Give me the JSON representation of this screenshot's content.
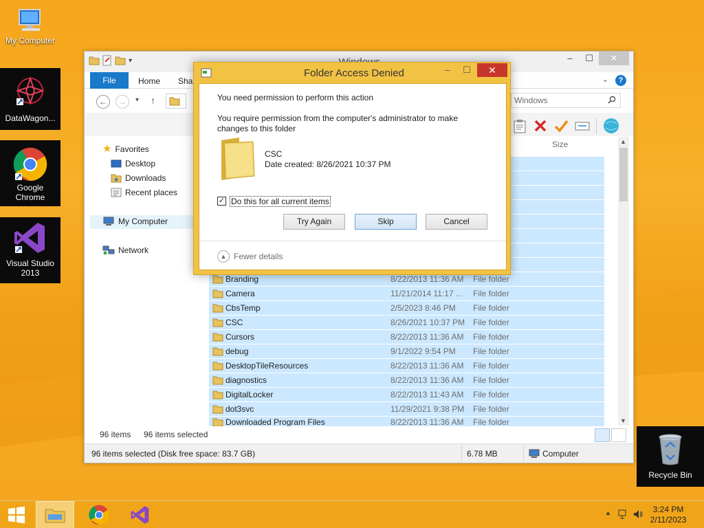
{
  "desktop": {
    "icons": [
      {
        "label": "My Computer"
      },
      {
        "label": "DataWagon..."
      },
      {
        "label": "Google\nChrome"
      },
      {
        "label": "Visual Studio\n2013"
      },
      {
        "label": "Recycle Bin"
      }
    ]
  },
  "explorer": {
    "title": "Windows",
    "tabs": {
      "file": "File",
      "home": "Home",
      "share": "Shar"
    },
    "search_placeholder": "Windows",
    "column_size": "Size",
    "nav": {
      "favorites": "Favorites",
      "desktop": "Desktop",
      "downloads": "Downloads",
      "recent": "Recent places",
      "computer": "My Computer",
      "network": "Network"
    },
    "rows": [
      {
        "name": "Branding",
        "date": "8/22/2013 11:36 AM",
        "type": "File folder"
      },
      {
        "name": "Camera",
        "date": "11/21/2014 11:17 ...",
        "type": "File folder"
      },
      {
        "name": "CbsTemp",
        "date": "2/5/2023 8:46 PM",
        "type": "File folder"
      },
      {
        "name": "CSC",
        "date": "8/26/2021 10:37 PM",
        "type": "File folder"
      },
      {
        "name": "Cursors",
        "date": "8/22/2013 11:36 AM",
        "type": "File folder"
      },
      {
        "name": "debug",
        "date": "9/1/2022 9:54 PM",
        "type": "File folder"
      },
      {
        "name": "DesktopTileResources",
        "date": "8/22/2013 11:36 AM",
        "type": "File folder"
      },
      {
        "name": "diagnostics",
        "date": "8/22/2013 11:36 AM",
        "type": "File folder"
      },
      {
        "name": "DigitalLocker",
        "date": "8/22/2013 11:43 AM",
        "type": "File folder"
      },
      {
        "name": "dot3svc",
        "date": "11/29/2021 9:38 PM",
        "type": "File folder"
      },
      {
        "name": "Downloaded Program Files",
        "date": "8/22/2013 11:36 AM",
        "type": "File folder"
      }
    ],
    "status": {
      "items": "96 items",
      "selected": "96 items selected"
    },
    "bottom": {
      "info": "96 items selected (Disk free space: 83.7 GB)",
      "size": "6.78 MB",
      "location": "Computer"
    }
  },
  "dialog": {
    "title": "Folder Access Denied",
    "heading": "You need permission to perform this action",
    "message": "You require permission from the computer's administrator to make changes to this folder",
    "folder_name": "CSC",
    "date_created": "Date created: 8/26/2021 10:37 PM",
    "checkbox_label": "Do this for all current items",
    "checkbox_checked": true,
    "checkmark": "✓",
    "buttons": {
      "try_again": "Try Again",
      "skip": "Skip",
      "cancel": "Cancel"
    },
    "fewer_details": "Fewer details"
  },
  "taskbar": {
    "time": "3:24 PM",
    "date": "2/11/2023"
  },
  "colors": {
    "accent": "#1979ca",
    "dialog_frame": "#f2c243",
    "close_red": "#c7362b",
    "selection": "#cce8ff",
    "wallpaper": "#f5a51a"
  }
}
